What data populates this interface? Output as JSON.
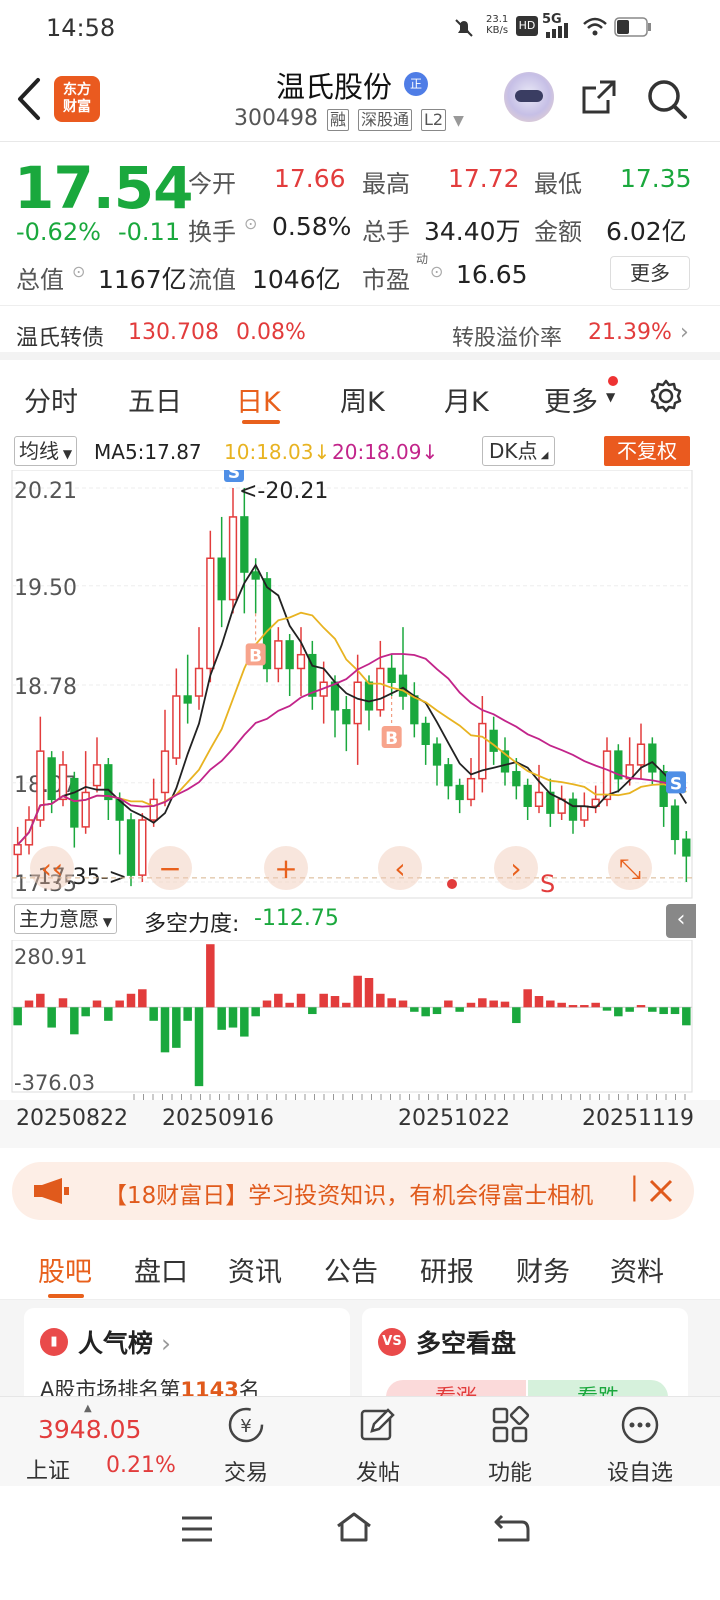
{
  "status_bar": {
    "time": "14:58",
    "net_speed": "23.1",
    "net_unit": "KB/s",
    "network": "5G",
    "hd": "HD"
  },
  "header": {
    "back_icon": "back-chevron-icon",
    "logo_line1": "东方",
    "logo_line2": "财富",
    "name": "温氏股份",
    "badge": "正",
    "code": "300498",
    "tags": [
      "融",
      "深股通",
      "L2"
    ]
  },
  "quote": {
    "price": "17.54",
    "change_pct": "-0.62%",
    "change_val": "-0.11",
    "open_label": "今开",
    "open": "17.66",
    "high_label": "最高",
    "high": "17.72",
    "low_label": "最低",
    "low": "17.35",
    "turnover_label": "换手",
    "turnover": "0.58%",
    "volume_label": "总手",
    "volume": "34.40万",
    "amount_label": "金额",
    "amount": "6.02亿",
    "mktcap_label": "总值",
    "mktcap": "1167亿",
    "float_label": "流值",
    "float": "1046亿",
    "pe_label": "市盈",
    "pe_sup": "动",
    "pe": "16.65",
    "more": "更多"
  },
  "convertible": {
    "name": "温氏转债",
    "price": "130.708",
    "pct": "0.08%",
    "premium_label": "转股溢价率",
    "premium": "21.39%"
  },
  "chart_tabs": [
    "分时",
    "五日",
    "日K",
    "周K",
    "月K",
    "更多"
  ],
  "chart_tabs_active": 2,
  "ma_row": {
    "selector": "均线",
    "ma5": "MA5:17.87",
    "ma10": "10:18.03",
    "ma20": "20:18.09",
    "dk": "DK点",
    "adjust": "不复权"
  },
  "colors": {
    "up": "#e23c3c",
    "down": "#1aa83d",
    "accent": "#e8601c",
    "ma5": "#222222",
    "ma10": "#e8b321",
    "ma20": "#c2248a"
  },
  "chart_data": [
    {
      "type": "candlestick",
      "y_ticks": [
        "20.21",
        "19.50",
        "18.78",
        "18.07",
        "17.35"
      ],
      "ylim": [
        17.35,
        20.21
      ],
      "max_label": "<-20.21",
      "min_label": "17.35->",
      "markers": [
        {
          "label": "S",
          "index": 19
        },
        {
          "label": "B",
          "index": 21
        },
        {
          "label": "B",
          "index": 33
        },
        {
          "label": "S",
          "index": 58
        }
      ],
      "candles": [
        [
          17.55,
          17.62,
          17.75,
          17.4
        ],
        [
          17.62,
          17.8,
          17.9,
          17.55
        ],
        [
          17.8,
          18.3,
          18.55,
          17.75
        ],
        [
          18.25,
          17.95,
          18.3,
          17.85
        ],
        [
          17.95,
          18.2,
          18.3,
          17.9
        ],
        [
          18.1,
          17.75,
          18.15,
          17.6
        ],
        [
          17.75,
          18.0,
          18.3,
          17.7
        ],
        [
          18.05,
          18.2,
          18.4,
          18.0
        ],
        [
          18.2,
          17.95,
          18.25,
          17.8
        ],
        [
          17.95,
          17.8,
          18.0,
          17.55
        ],
        [
          17.8,
          17.4,
          17.85,
          17.32
        ],
        [
          17.4,
          17.8,
          17.85,
          17.35
        ],
        [
          17.8,
          17.95,
          18.1,
          17.75
        ],
        [
          18.0,
          18.3,
          18.6,
          17.9
        ],
        [
          18.25,
          18.7,
          18.9,
          18.2
        ],
        [
          18.7,
          18.65,
          19.0,
          18.5
        ],
        [
          18.7,
          18.9,
          19.2,
          18.6
        ],
        [
          18.9,
          19.7,
          19.9,
          18.8
        ],
        [
          19.7,
          19.4,
          20.0,
          19.2
        ],
        [
          19.4,
          20.0,
          20.21,
          19.3
        ],
        [
          20.0,
          19.6,
          20.21,
          19.3
        ],
        [
          19.6,
          19.55,
          19.7,
          19.3
        ],
        [
          19.55,
          18.9,
          19.6,
          18.8
        ],
        [
          18.9,
          19.1,
          19.2,
          18.8
        ],
        [
          19.1,
          18.9,
          19.15,
          18.7
        ],
        [
          18.9,
          19.0,
          19.2,
          18.7
        ],
        [
          19.0,
          18.7,
          19.1,
          18.6
        ],
        [
          18.7,
          18.8,
          18.95,
          18.5
        ],
        [
          18.8,
          18.6,
          18.85,
          18.4
        ],
        [
          18.6,
          18.5,
          18.7,
          18.3
        ],
        [
          18.5,
          18.8,
          19.0,
          18.2
        ],
        [
          18.8,
          18.6,
          18.85,
          18.45
        ],
        [
          18.6,
          18.9,
          19.1,
          18.55
        ],
        [
          18.9,
          18.8,
          19.0,
          18.7
        ],
        [
          18.85,
          18.7,
          19.2,
          18.6
        ],
        [
          18.7,
          18.5,
          18.8,
          18.4
        ],
        [
          18.5,
          18.35,
          18.55,
          18.2
        ],
        [
          18.35,
          18.2,
          18.4,
          18.05
        ],
        [
          18.2,
          18.05,
          18.25,
          17.95
        ],
        [
          18.05,
          17.95,
          18.1,
          17.85
        ],
        [
          17.95,
          18.1,
          18.25,
          17.9
        ],
        [
          18.1,
          18.5,
          18.7,
          18.0
        ],
        [
          18.45,
          18.3,
          18.55,
          18.2
        ],
        [
          18.3,
          18.15,
          18.4,
          18.05
        ],
        [
          18.15,
          18.05,
          18.25,
          17.95
        ],
        [
          18.05,
          17.9,
          18.1,
          17.8
        ],
        [
          17.9,
          18.0,
          18.2,
          17.85
        ],
        [
          18.0,
          17.85,
          18.1,
          17.75
        ],
        [
          17.85,
          17.95,
          18.05,
          17.8
        ],
        [
          17.95,
          17.8,
          18.0,
          17.7
        ],
        [
          17.8,
          17.9,
          18.0,
          17.75
        ],
        [
          17.9,
          17.95,
          18.05,
          17.85
        ],
        [
          17.95,
          18.3,
          18.4,
          17.9
        ],
        [
          18.3,
          18.1,
          18.35,
          18.0
        ],
        [
          18.1,
          18.2,
          18.4,
          18.05
        ],
        [
          18.2,
          18.35,
          18.5,
          18.1
        ],
        [
          18.35,
          18.15,
          18.4,
          18.05
        ],
        [
          18.15,
          17.9,
          18.2,
          17.75
        ],
        [
          17.9,
          17.66,
          17.95,
          17.55
        ],
        [
          17.66,
          17.54,
          17.72,
          17.35
        ]
      ]
    },
    {
      "type": "bar",
      "title": "主力意愿",
      "indicator_label": "多空力度:",
      "indicator_value": "-112.75",
      "y_ticks": [
        "280.91",
        "-376.03"
      ],
      "ylim": [
        -376.03,
        280.91
      ],
      "values": [
        -80,
        30,
        60,
        -90,
        40,
        -120,
        -40,
        30,
        -60,
        30,
        60,
        80,
        -60,
        -200,
        -180,
        -60,
        -350,
        280,
        -100,
        -90,
        -130,
        -40,
        30,
        60,
        20,
        60,
        -30,
        60,
        50,
        20,
        140,
        130,
        60,
        40,
        30,
        -20,
        -40,
        -30,
        30,
        -20,
        20,
        40,
        30,
        25,
        -70,
        80,
        50,
        30,
        20,
        10,
        10,
        20,
        -15,
        -40,
        -20,
        10,
        -20,
        -30,
        -30,
        -80
      ],
      "date_labels": [
        "20250822",
        "20250916",
        "20251022",
        "20251119"
      ]
    }
  ],
  "banner": {
    "text": "【18财富日】学习投资知识，有机会得富士相机"
  },
  "bottom_tabs": [
    "股吧",
    "盘口",
    "资讯",
    "公告",
    "研报",
    "财务",
    "资料"
  ],
  "bottom_tabs_active": 0,
  "cards": [
    {
      "title": "人气榜",
      "icon": "VS",
      "sub_prefix": "A股市场排名第",
      "rank": "1143",
      "sub_suffix": "名"
    },
    {
      "title": "多空看盘",
      "icon": "VS",
      "sub_left": "看涨",
      "sub_right": "看跌"
    }
  ],
  "bottom_nav": {
    "index_value": "3948.05",
    "index_name": "上证",
    "index_pct": "0.21%",
    "items": [
      "交易",
      "发帖",
      "功能",
      "设自选"
    ]
  }
}
